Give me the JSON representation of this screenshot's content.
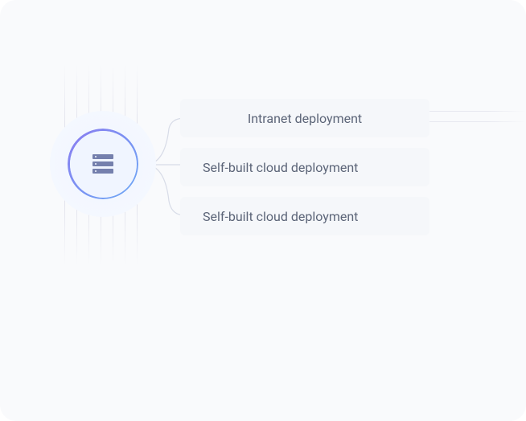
{
  "icon": "server-icon",
  "options": [
    {
      "label": "Intranet deployment"
    },
    {
      "label": "Self-built cloud deployment"
    },
    {
      "label": "Self-built cloud deployment"
    }
  ]
}
